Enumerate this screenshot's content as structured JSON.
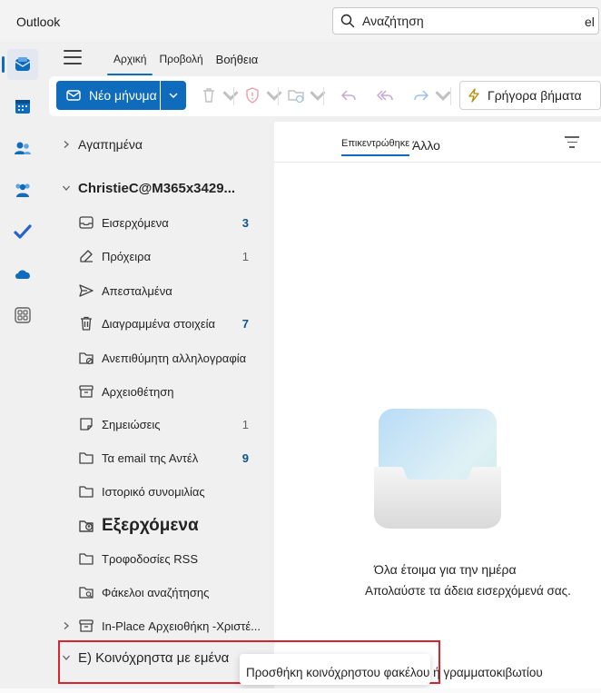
{
  "app": {
    "title": "Outlook"
  },
  "search": {
    "placeholder": "Αναζήτηση"
  },
  "ribbon": {
    "tabs": [
      {
        "label": "Αρχική"
      },
      {
        "label": "Προβολή"
      },
      {
        "label": "Βοήθεια"
      }
    ],
    "active_tab": "Αρχική"
  },
  "toolbar": {
    "new_message": "Νέο μήνυμα",
    "quick_steps": "Γρήγορα βήματα",
    "quick_extra": "el"
  },
  "folders": {
    "favorites": "Αγαπημένα",
    "account": "ChristieC@M365x3429...",
    "items": [
      {
        "label": "Εισερχόμενα",
        "count": "3",
        "icon": "inbox-icon"
      },
      {
        "label": "Πρόχειρα",
        "count": "1",
        "icon": "drafts-icon"
      },
      {
        "label": "Απεσταλμένα",
        "count": "",
        "icon": "sent-icon"
      },
      {
        "label": "Διαγραμμένα στοιχεία",
        "count": "7",
        "icon": "trash-icon"
      },
      {
        "label": "Ανεπιθύμητη αλληλογραφία",
        "count": "",
        "icon": "junk-icon"
      },
      {
        "label": "Αρχειοθέτηση",
        "count": "",
        "icon": "archive-icon"
      },
      {
        "label": "Σημειώσεις",
        "count": "1",
        "icon": "notes-icon"
      },
      {
        "label": "Τα email της Αντέλ",
        "count": "9",
        "icon": "folder-icon"
      },
      {
        "label": "Ιστορικό συνομιλίας",
        "count": "",
        "icon": "folder-icon"
      },
      {
        "label": "Εξερχόμενα",
        "count": "",
        "icon": "outbox-icon"
      },
      {
        "label": "Τροφοδοσίες RSS",
        "count": "",
        "icon": "folder-icon"
      },
      {
        "label": "Φάκελοι αναζήτησης",
        "count": "",
        "icon": "search-folder-icon"
      }
    ],
    "in_place_archive": "In-Place Αρχειοθήκη -Χριστέ...",
    "shared_with_me": "Ε) Κοινόχρηστα με εμένα"
  },
  "message_list": {
    "pivot_focused": "Επικεντρώθηκε",
    "pivot_other": "Άλλο",
    "empty_title": "Όλα έτοιμα για την ημέρα",
    "empty_subtitle": "Απολαύστε τα άδεια εισερχόμενά σας."
  },
  "tooltip": {
    "text": "Προσθήκη κοινόχρηστου φακέλου ή γραμματοκιβωτίου"
  },
  "colors": {
    "accent": "#0f6cbd",
    "highlight": "#d9232d"
  }
}
